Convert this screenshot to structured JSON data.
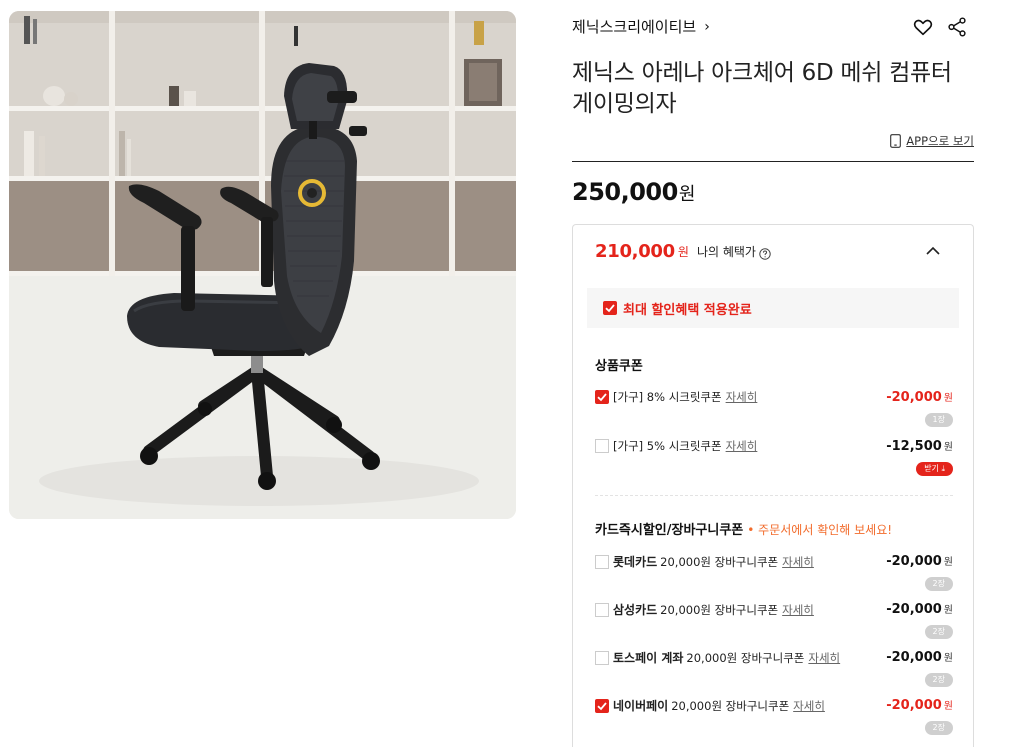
{
  "header": {
    "brand": "제닉스크리에이티브",
    "brand_chevron": "›",
    "title": "제닉스 아레나 아크체어 6D 메쉬 컴퓨터 게이밍의자",
    "app_link": "APP으로 보기"
  },
  "price": {
    "amount": "250,000",
    "unit": "원"
  },
  "benefit": {
    "price": "210,000",
    "unit": "원",
    "label": "나의 혜택가",
    "applied_text": "최대 할인혜택 적용완료"
  },
  "product_coupons": {
    "title": "상품쿠폰",
    "items": [
      {
        "checked": true,
        "name": "[가구] 8% 시크릿쿠폰",
        "detail": "자세히",
        "amount": "-20,000",
        "unit": "원",
        "badge": "1장"
      },
      {
        "checked": false,
        "name": "[가구] 5% 시크릿쿠폰",
        "detail": "자세히",
        "amount": "-12,500",
        "unit": "원",
        "badge": "받기 ⤓"
      }
    ]
  },
  "card_coupons": {
    "title": "카드즉시할인/장바구니쿠폰",
    "note": "• 주문서에서 확인해 보세요!",
    "items": [
      {
        "checked": false,
        "strong": "롯데카드",
        "name": "20,000원 장바구니쿠폰",
        "detail": "자세히",
        "amount": "-20,000",
        "unit": "원",
        "badge": "2장"
      },
      {
        "checked": false,
        "strong": "삼성카드",
        "name": "20,000원 장바구니쿠폰",
        "detail": "자세히",
        "amount": "-20,000",
        "unit": "원",
        "badge": "2장"
      },
      {
        "checked": false,
        "strong": "토스페이 계좌",
        "name": "20,000원 장바구니쿠폰",
        "detail": "자세히",
        "amount": "-20,000",
        "unit": "원",
        "badge": "2장"
      },
      {
        "checked": true,
        "strong": "네이버페이",
        "name": "20,000원 장바구니쿠폰",
        "detail": "자세히",
        "amount": "-20,000",
        "unit": "원",
        "badge": "2장"
      }
    ]
  },
  "icons": {
    "like": "heart-icon",
    "share": "share-icon",
    "app": "phone-icon",
    "collapse": "chevron-up-icon",
    "info": "info-icon"
  },
  "colors": {
    "accent": "#e4241b",
    "note": "#f26b2b",
    "badge": "#cfcfcf"
  }
}
